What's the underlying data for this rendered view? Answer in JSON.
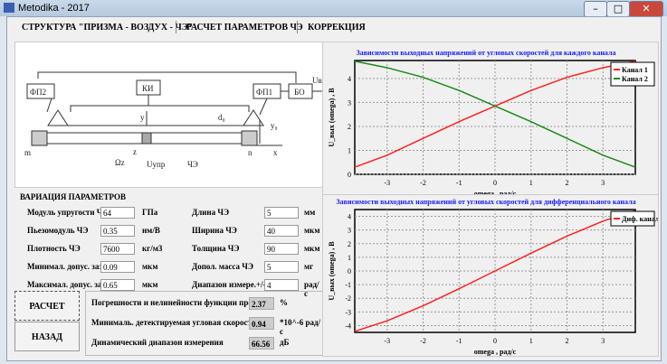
{
  "window": {
    "title": "Metodika - 2017",
    "minimize": "–",
    "maximize": "□",
    "close": "✕"
  },
  "tabs": [
    {
      "label": "СТРУКТУРА \"ПРИЗМА - ВОЗДУХ - ЧЭ\""
    },
    {
      "label": "РАСЧЕТ ПАРАМЕТРОВ ЧЭ"
    },
    {
      "label": "КОРРЕКЦИЯ"
    }
  ],
  "diagram": {
    "fp2": "ФП2",
    "ki": "КИ",
    "fp1": "ФП1",
    "bo": "БО",
    "uvyh": "Uвых",
    "y": "y",
    "d0": "d₀",
    "y0": "y₀",
    "m": "m",
    "n": "n",
    "x": "x",
    "z": "z",
    "omega": "Ωz",
    "uupr": "Uупр",
    "ce": "ЧЭ"
  },
  "params": {
    "title": "ВАРИАЦИЯ ПАРАМЕТРОВ",
    "left": [
      {
        "label": "Модуль упругости ЧЭ",
        "value": "64",
        "unit": "ГПа"
      },
      {
        "label": "Пьезомодуль ЧЭ",
        "value": "0.35",
        "unit": "нм/В"
      },
      {
        "label": "Плотность ЧЭ",
        "value": "7600",
        "unit": "кг/м3"
      },
      {
        "label": "Минимал. допус. зазор",
        "value": "0.09",
        "unit": "мкм"
      },
      {
        "label": "Максимал. допус. зазор",
        "value": "0.65",
        "unit": "мкм"
      }
    ],
    "right": [
      {
        "label": "Длина ЧЭ",
        "value": "5",
        "unit": "мм"
      },
      {
        "label": "Ширина ЧЭ",
        "value": "40",
        "unit": "мкм"
      },
      {
        "label": "Толщина ЧЭ",
        "value": "90",
        "unit": "мкм"
      },
      {
        "label": "Допол. масса ЧЭ",
        "value": "5",
        "unit": "мг"
      },
      {
        "label": "Диапазон измере.+/-",
        "value": "4",
        "unit": "рад/с"
      }
    ]
  },
  "buttons": {
    "calc": "РАСЧЕТ",
    "back": "НАЗАД"
  },
  "results": [
    {
      "label": "Погрешности и нелинейности функции преоб.",
      "value": "2.37",
      "unit": "%"
    },
    {
      "label": "Минималь. детектируемая угловая скорость",
      "value": "0.94",
      "unit": "*10^-6  рад/с"
    },
    {
      "label": "Динамический диапазон измерения",
      "value": "66.56",
      "unit": "дБ"
    }
  ],
  "chart_data": [
    {
      "type": "line",
      "title": "Зависимости выходных напряжений от угловых скоростей для каждого канала",
      "xlabel": "omega , рад/с",
      "ylabel": "U_вых (omega) , В",
      "xlim": [
        -3.9,
        3.9
      ],
      "ylim": [
        0,
        4.75
      ],
      "xticks": [
        -3,
        -2,
        -1,
        0,
        1,
        2,
        3
      ],
      "yticks": [
        0,
        1,
        2,
        3,
        4
      ],
      "grid": true,
      "legend": "top-right",
      "x": [
        -3.9,
        -3,
        -2,
        -1,
        0,
        1,
        2,
        3,
        3.9
      ],
      "series": [
        {
          "name": "Канал 1",
          "color": "#ff2020",
          "values": [
            0.3,
            0.8,
            1.5,
            2.2,
            2.85,
            3.5,
            4.05,
            4.45,
            4.72
          ]
        },
        {
          "name": "Канал 2",
          "color": "#1a8a1a",
          "values": [
            4.72,
            4.45,
            4.05,
            3.5,
            2.85,
            2.2,
            1.5,
            0.8,
            0.3
          ]
        }
      ]
    },
    {
      "type": "line",
      "title": "Зависимости выходных напряжений от угловых скоростей для дифференциального канала",
      "xlabel": "omega , рад/с",
      "ylabel": "U_вых (omega) , В",
      "xlim": [
        -3.9,
        3.9
      ],
      "ylim": [
        -4.5,
        4.5
      ],
      "xticks": [
        -3,
        -2,
        -1,
        0,
        1,
        2,
        3
      ],
      "yticks": [
        -4,
        -3,
        -2,
        -1,
        0,
        1,
        2,
        3,
        4
      ],
      "grid": true,
      "legend": "top-right",
      "x": [
        -3.9,
        -3,
        -2,
        -1,
        0,
        1,
        2,
        3,
        3.9
      ],
      "series": [
        {
          "name": "Диф. канал",
          "color": "#ff2020",
          "values": [
            -4.42,
            -3.65,
            -2.55,
            -1.3,
            0,
            1.3,
            2.55,
            3.65,
            4.42
          ]
        }
      ]
    }
  ]
}
